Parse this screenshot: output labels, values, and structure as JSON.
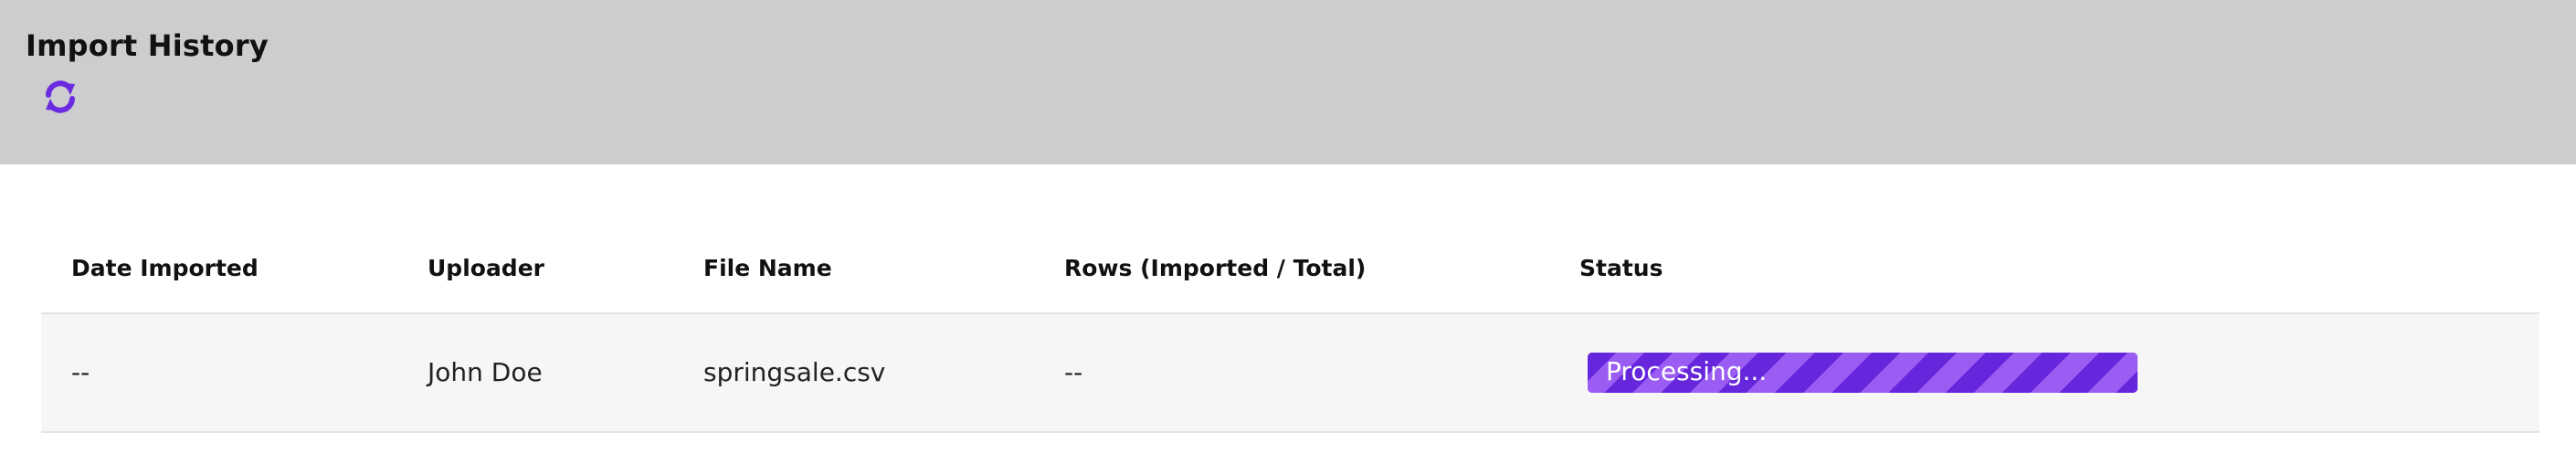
{
  "page": {
    "title": "Import History",
    "refresh_icon": "refresh-icon"
  },
  "colors": {
    "accent": "#6a2be0",
    "header_background": "#cdcdcf",
    "row_background": "#f6f6f6"
  },
  "table": {
    "columns": [
      "Date Imported",
      "Uploader",
      "File Name",
      "Rows (Imported / Total)",
      "Status"
    ],
    "rows": [
      {
        "date_imported": "--",
        "uploader": "John Doe",
        "file_name": "springsale.csv",
        "rows_imported_total": "--",
        "status": {
          "label": "Processing...",
          "progress": 1.0
        }
      }
    ]
  }
}
